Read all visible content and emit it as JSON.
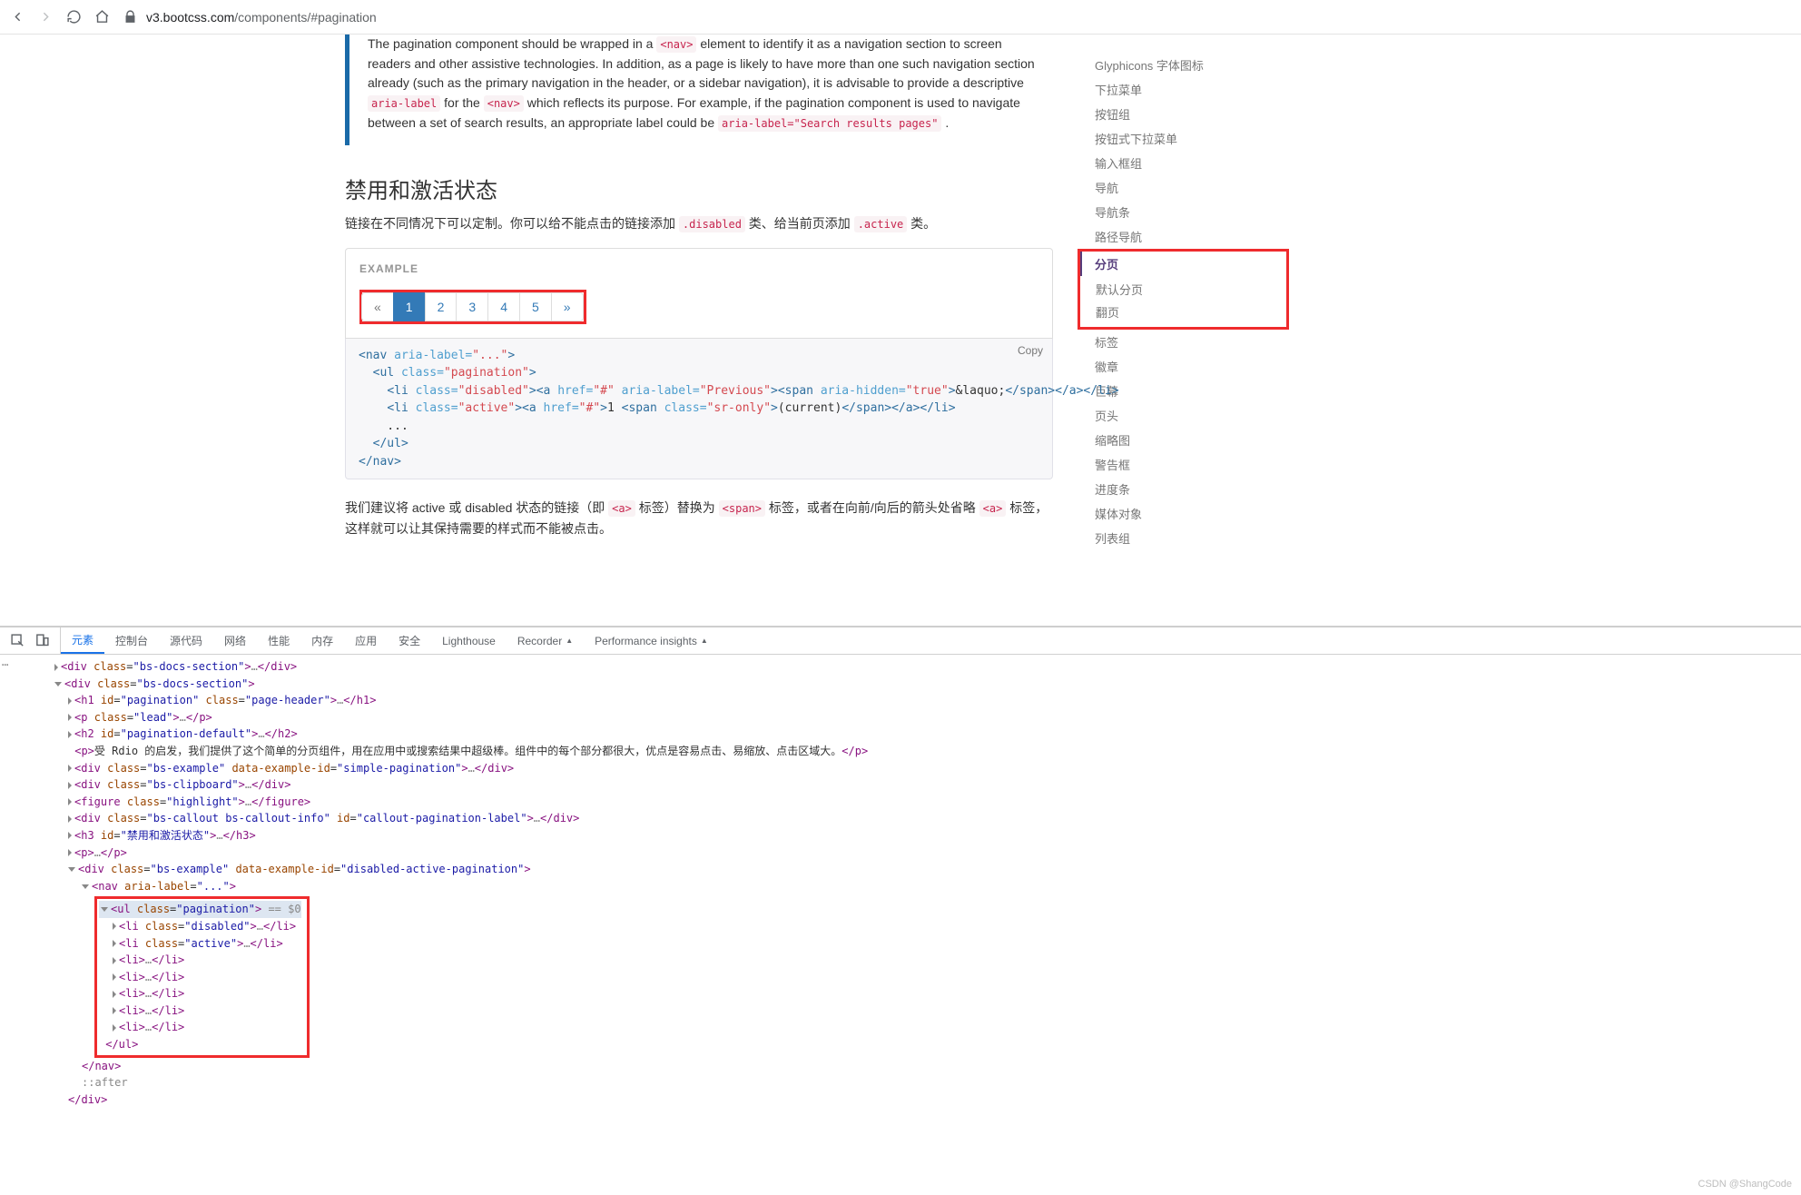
{
  "browser": {
    "url_host": "v3.bootcss.com",
    "url_path": "/components/#pagination"
  },
  "callout": {
    "line1a": "The pagination component should be wrapped in a ",
    "nav_code": "<nav>",
    "line1b": " element to identify it as a navigation section to screen readers and other assistive technologies. In addition, as a page is likely to have more than one such navigation section already (such as the primary navigation in the header, or a sidebar navigation), it is advisable to provide a descriptive ",
    "aria_code": "aria-label",
    "line1c": " for the ",
    "line1d": " which reflects its purpose. For example, if the pagination component is used to navigate between a set of search results, an appropriate label could be ",
    "aria_ex": "aria-label=\"Search results pages\"",
    "period": " ."
  },
  "section": {
    "title": "禁用和激活状态",
    "p1a": "链接在不同情况下可以定制。你可以给不能点击的链接添加 ",
    "disabled_code": ".disabled",
    "p1b": " 类、给当前页添加 ",
    "active_code": ".active",
    "p1c": " 类。"
  },
  "example": {
    "label": "EXAMPLE",
    "items": [
      "«",
      "1",
      "2",
      "3",
      "4",
      "5",
      "»"
    ],
    "active_index": 1,
    "disabled_index": 0
  },
  "copy_label": "Copy",
  "after_p": {
    "a": "我们建议将 active 或 disabled 状态的链接（即 ",
    "a_tag": "<a>",
    "b": " 标签）替换为 ",
    "span_tag": "<span>",
    "c": " 标签，或者在向前/向后的箭头处省略 ",
    "d": " 标签，这样就可以让其保持需要的样式而不能被点击。"
  },
  "sidenav": {
    "items": [
      "Glyphicons 字体图标",
      "下拉菜单",
      "按钮组",
      "按钮式下拉菜单",
      "输入框组",
      "导航",
      "导航条",
      "路径导航"
    ],
    "active": "分页",
    "sub": [
      "默认分页",
      "翻页"
    ],
    "items_after": [
      "标签",
      "徽章",
      "巨幕",
      "页头",
      "缩略图",
      "警告框",
      "进度条",
      "媒体对象",
      "列表组"
    ]
  },
  "devtools": {
    "tabs": [
      "元素",
      "控制台",
      "源代码",
      "网络",
      "性能",
      "内存",
      "应用",
      "安全",
      "Lighthouse",
      "Recorder",
      "Performance insights"
    ],
    "dom_intro_p": "受 Rdio 的启发，我们提供了这个简单的分页组件，用在应用中或搜索结果中超级棒。组件中的每个部分都很大，优点是容易点击、易缩放、点击区域大。",
    "h3_text": "禁用和激活状态",
    "sel_marker": " == $0",
    "after_pseudo": "::after"
  },
  "watermark": "CSDN @ShangCode"
}
